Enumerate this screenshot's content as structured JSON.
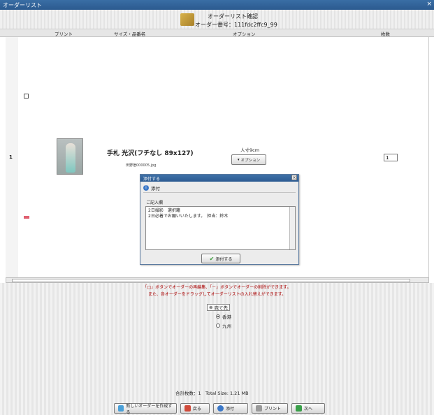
{
  "window": {
    "title": "オーダーリスト",
    "close": "×"
  },
  "header": {
    "title": "オーダーリスト確認",
    "order_number": "オーダー番号：111fdc2ffc9_99"
  },
  "columns": {
    "print": "プリント",
    "size_name": "サイズ・品番名",
    "option": "オプション",
    "qty": "枚数"
  },
  "row": {
    "index": "1",
    "name": "手札 光沢(フチなし 89x127)",
    "file": "田野宿000005.jpg",
    "size": "人寸9cm",
    "option_button": "オプション",
    "quantity": "1"
  },
  "dialog": {
    "title": "添付する",
    "heading": "添付",
    "label": "ご記入欄",
    "text_line1": "2日撮影　選択籍",
    "text_line2": "2日必着でお願いいたします。　担当：鈴木",
    "attach_button": "添付する"
  },
  "hints": {
    "line1": "「□」ボタンでオーダーの再編集、「－」ボタンでオーダーの削除ができます。",
    "line2": "また、各オーダーをドラッグしてオーダーリストの入れ替えができます。"
  },
  "destination": {
    "label": "宛て先",
    "options": [
      {
        "label": "香港",
        "selected": true
      },
      {
        "label": "九州",
        "selected": false
      }
    ]
  },
  "summary": "合計枚数：1　Total Size: 1.21 MB",
  "buttons": {
    "new_order": "新しいオーダーを作成する",
    "back": "戻る",
    "attach": "添付",
    "print": "プリント",
    "next": "次へ"
  },
  "colors": {
    "titlebar": "#2b5a8f",
    "delete": "#e06070",
    "hint_text": "#aa0000"
  }
}
